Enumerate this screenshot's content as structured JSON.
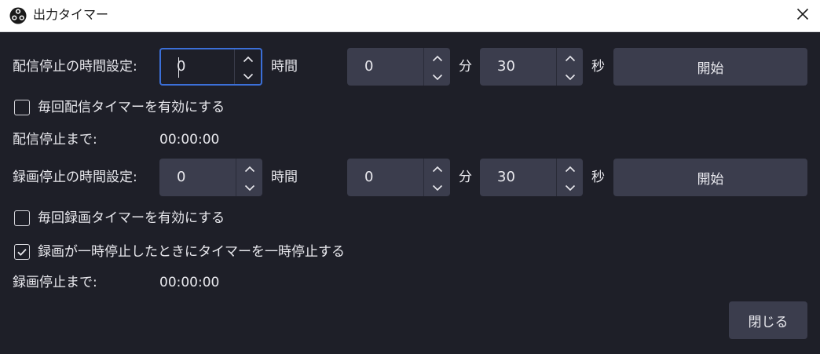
{
  "window": {
    "title": "出力タイマー",
    "close_icon": "close-icon",
    "app_icon": "obs-logo-icon"
  },
  "stream": {
    "set_label": "配信停止の時間設定:",
    "hours": "0",
    "hours_unit": "時間",
    "minutes": "0",
    "minutes_unit": "分",
    "seconds": "30",
    "seconds_unit": "秒",
    "start_label": "開始",
    "every_time_label": "毎回配信タイマーを有効にする",
    "every_time_checked": false,
    "remaining_label": "配信停止まで:",
    "remaining_value": "00:00:00"
  },
  "record": {
    "set_label": "録画停止の時間設定:",
    "hours": "0",
    "hours_unit": "時間",
    "minutes": "0",
    "minutes_unit": "分",
    "seconds": "30",
    "seconds_unit": "秒",
    "start_label": "開始",
    "every_time_label": "毎回録画タイマーを有効にする",
    "every_time_checked": false,
    "pause_label": "録画が一時停止したときにタイマーを一時停止する",
    "pause_checked": true,
    "remaining_label": "録画停止まで:",
    "remaining_value": "00:00:00"
  },
  "footer": {
    "close_label": "閉じる"
  },
  "colors": {
    "background": "#1e1f28",
    "control": "#3b3d4d",
    "focus_border": "#3b6fd8",
    "text": "#e9e9ee",
    "titlebar": "#ffffff"
  }
}
